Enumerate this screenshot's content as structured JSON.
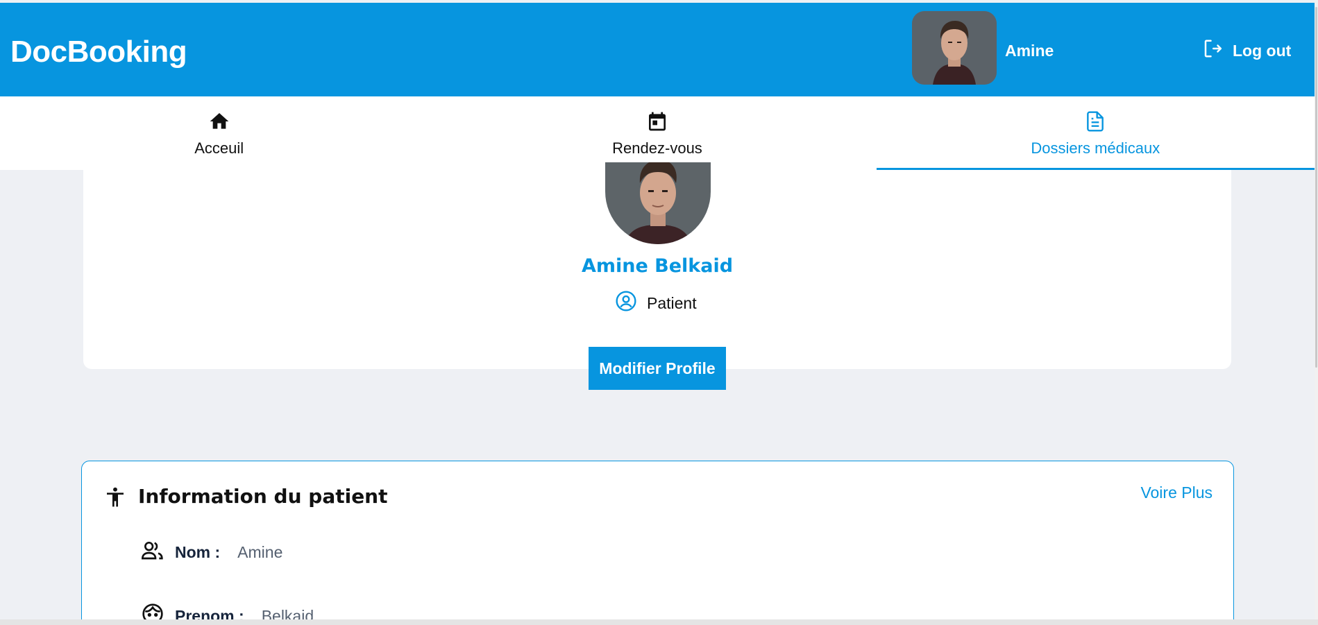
{
  "app": {
    "brand": "DocBooking"
  },
  "header": {
    "username": "Amine",
    "logout_label": "Log out"
  },
  "nav": {
    "tabs": [
      {
        "label": "Acceuil",
        "icon": "home-icon",
        "active": false
      },
      {
        "label": "Rendez-vous",
        "icon": "calendar-icon",
        "active": false
      },
      {
        "label": "Dossiers médicaux",
        "icon": "document-icon",
        "active": true
      }
    ]
  },
  "profile": {
    "full_name": "Amine Belkaid",
    "role": "Patient",
    "role_icon": "user-circle-icon",
    "edit_button": "Modifier Profile"
  },
  "patient_info": {
    "title": "Information du patient",
    "title_icon": "accessibility-icon",
    "see_more": "Voire Plus",
    "fields": [
      {
        "label": "Nom :",
        "value": "Amine",
        "icon": "people-icon"
      },
      {
        "label": "Prenom :",
        "value": "Belkaid",
        "icon": "face-icon"
      }
    ]
  },
  "colors": {
    "primary": "#0795df",
    "background": "#eef0f4",
    "white": "#ffffff"
  }
}
